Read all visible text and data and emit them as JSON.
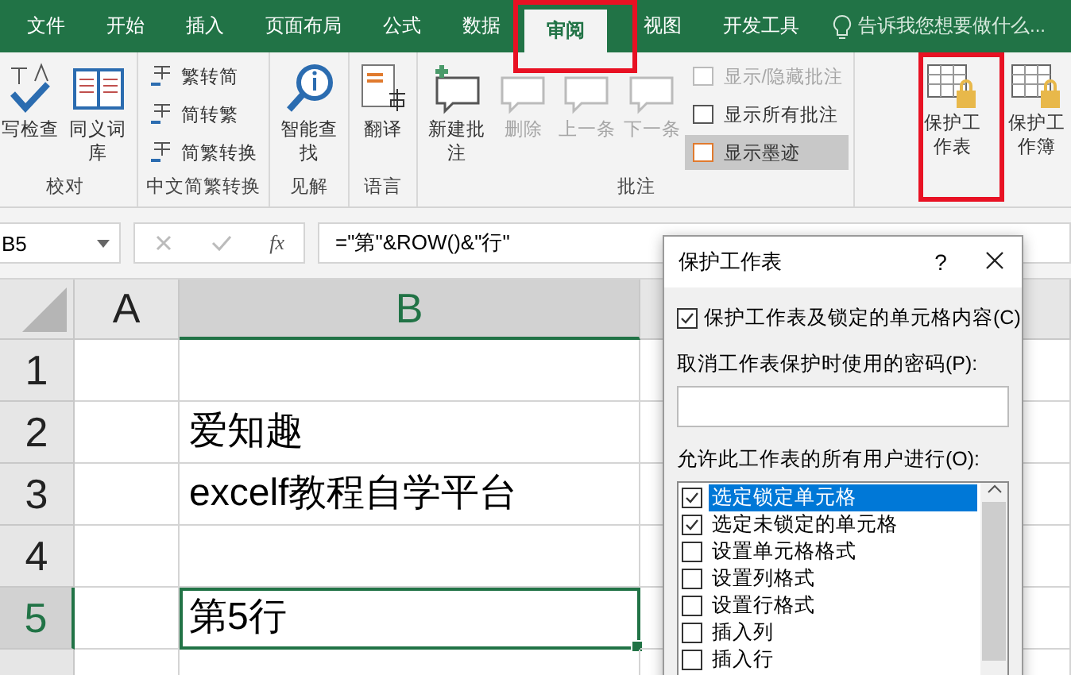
{
  "tabs": [
    {
      "label": "文件",
      "selected": false
    },
    {
      "label": "开始",
      "selected": false
    },
    {
      "label": "插入",
      "selected": false
    },
    {
      "label": "页面布局",
      "selected": false
    },
    {
      "label": "公式",
      "selected": false
    },
    {
      "label": "数据",
      "selected": false
    },
    {
      "label": "审阅",
      "selected": true
    },
    {
      "label": "视图",
      "selected": false
    },
    {
      "label": "开发工具",
      "selected": false
    }
  ],
  "tell_me": {
    "placeholder": "告诉我您想要做什么..."
  },
  "ribbon": {
    "groups": [
      {
        "label": "校对",
        "items": [
          {
            "label": "写检查",
            "kind": "large",
            "disabled": false,
            "pressed": false
          },
          {
            "label": "同义词库",
            "kind": "large",
            "disabled": false,
            "pressed": false
          }
        ]
      },
      {
        "label": "中文简繁转换",
        "items": [
          {
            "label": "繁转简",
            "kind": "small",
            "disabled": false,
            "pressed": false
          },
          {
            "label": "简转繁",
            "kind": "small",
            "disabled": false,
            "pressed": false
          },
          {
            "label": "简繁转换",
            "kind": "small",
            "disabled": false,
            "pressed": false
          }
        ]
      },
      {
        "label": "见解",
        "items": [
          {
            "label": "智能查找",
            "kind": "large",
            "disabled": false,
            "pressed": false
          }
        ]
      },
      {
        "label": "语言",
        "items": [
          {
            "label": "翻译",
            "kind": "large",
            "disabled": false,
            "pressed": false
          }
        ]
      },
      {
        "label": "批注",
        "items": [
          {
            "label": "新建批注",
            "kind": "large",
            "disabled": false,
            "pressed": false
          },
          {
            "label": "删除",
            "kind": "large",
            "disabled": true,
            "pressed": false
          },
          {
            "label": "上一条",
            "kind": "large",
            "disabled": true,
            "pressed": false
          },
          {
            "label": "下一条",
            "kind": "large",
            "disabled": true,
            "pressed": false
          },
          {
            "label": "显示/隐藏批注",
            "kind": "small",
            "disabled": true,
            "pressed": false
          },
          {
            "label": "显示所有批注",
            "kind": "small",
            "disabled": false,
            "pressed": false
          },
          {
            "label": "显示墨迹",
            "kind": "small",
            "disabled": false,
            "pressed": true
          }
        ]
      },
      {
        "items": [
          {
            "label": "保护工作表",
            "kind": "large",
            "disabled": false,
            "pressed": false
          },
          {
            "label": "保护工作簿",
            "kind": "large",
            "disabled": false,
            "pressed": false
          }
        ]
      }
    ]
  },
  "formula_bar": {
    "name_box": "B5",
    "fx": "fx",
    "formula": "=\"第\"&ROW()&\"行\""
  },
  "sheet": {
    "columns": [
      {
        "label": "A",
        "selected": false
      },
      {
        "label": "B",
        "selected": true
      }
    ],
    "rows": [
      {
        "label": "1",
        "selected": false,
        "b": ""
      },
      {
        "label": "2",
        "selected": false,
        "b": "爱知趣"
      },
      {
        "label": "3",
        "selected": false,
        "b": "excelf教程自学平台"
      },
      {
        "label": "4",
        "selected": false,
        "b": ""
      },
      {
        "label": "5",
        "selected": true,
        "b": "第5行"
      }
    ]
  },
  "dialog": {
    "title": "保护工作表",
    "help": "?",
    "protect": {
      "label": "保护工作表及锁定的单元格内容(C)",
      "checked": true
    },
    "password_label": "取消工作表保护时使用的密码(P):",
    "allow_label": "允许此工作表的所有用户进行(O):",
    "permissions": [
      {
        "label": "选定锁定单元格",
        "checked": true,
        "selected": true
      },
      {
        "label": "选定未锁定的单元格",
        "checked": true,
        "selected": false
      },
      {
        "label": "设置单元格格式",
        "checked": false,
        "selected": false
      },
      {
        "label": "设置列格式",
        "checked": false,
        "selected": false
      },
      {
        "label": "设置行格式",
        "checked": false,
        "selected": false
      },
      {
        "label": "插入列",
        "checked": false,
        "selected": false
      },
      {
        "label": "插入行",
        "checked": false,
        "selected": false
      }
    ]
  }
}
